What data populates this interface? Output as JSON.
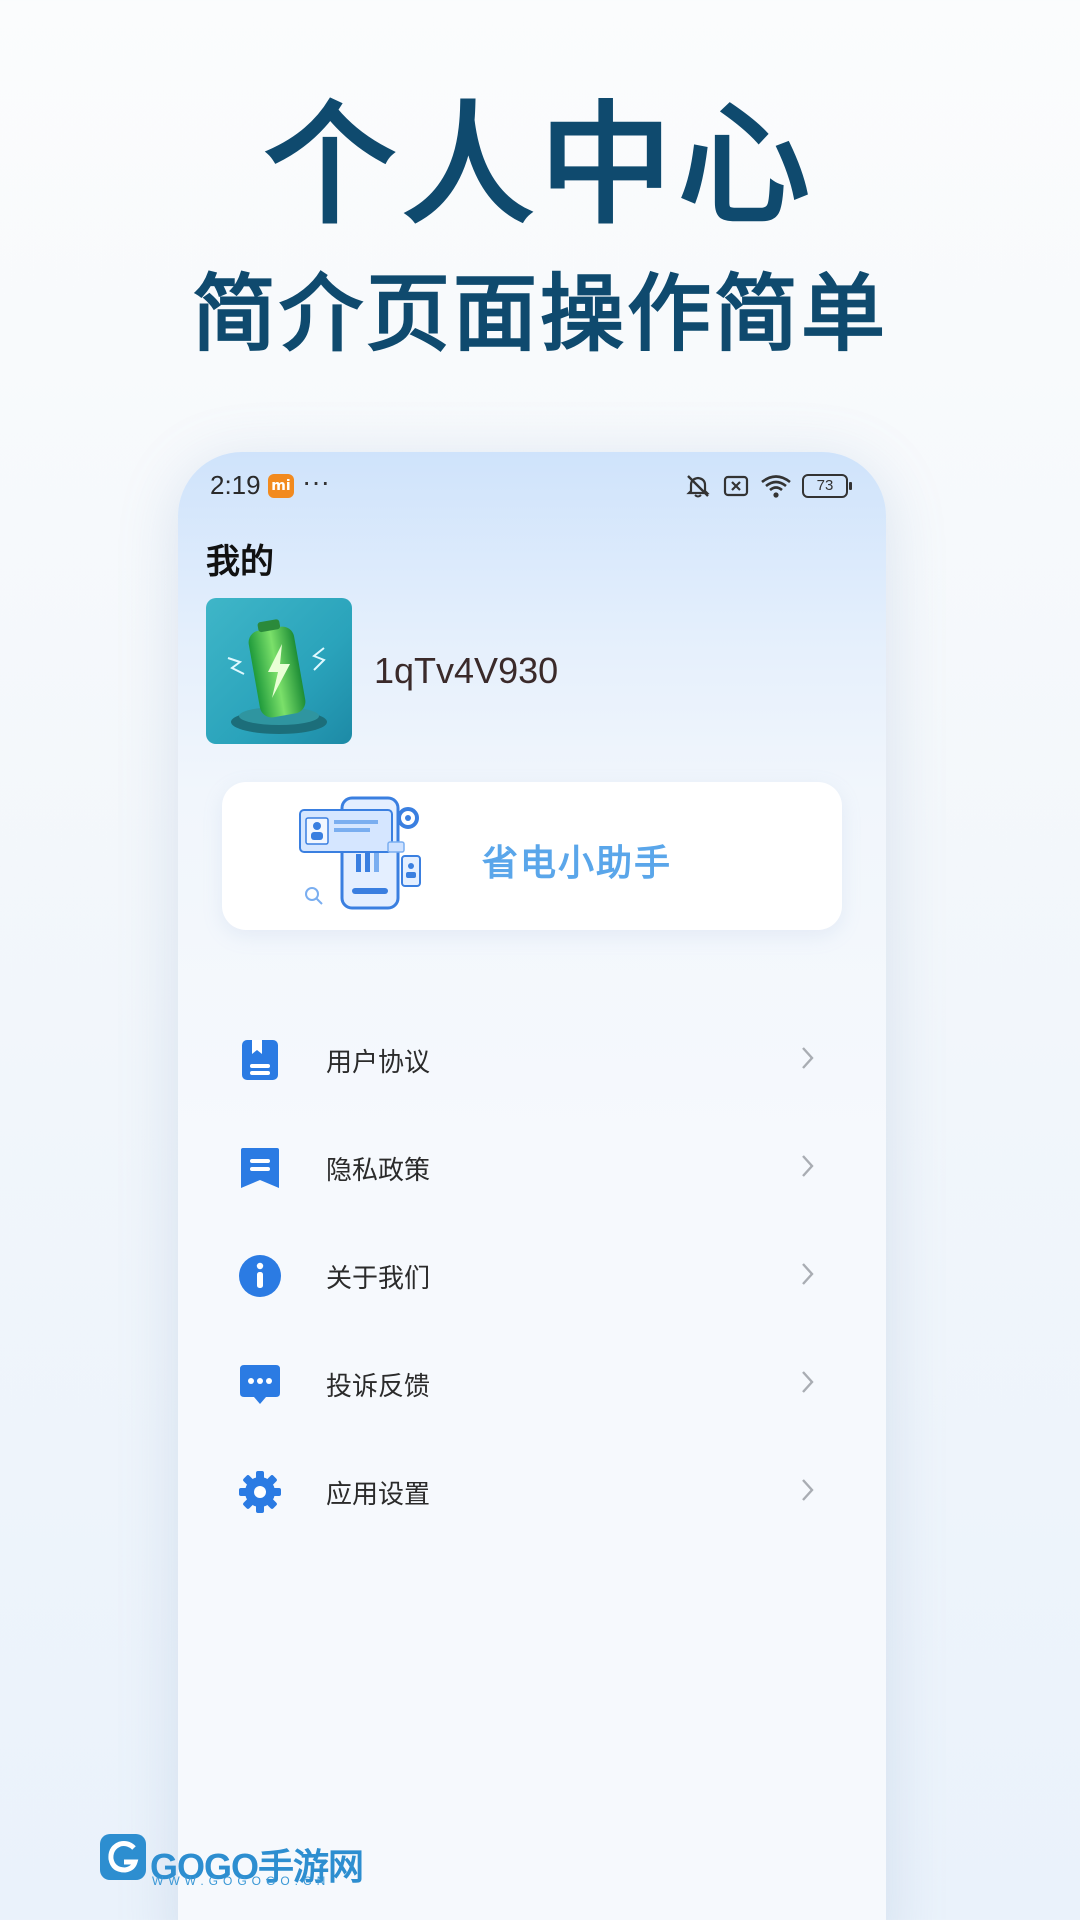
{
  "promo": {
    "title": "个人中心",
    "subtitle": "简介页面操作简单"
  },
  "status_bar": {
    "time": "2:19",
    "app_badge": "mi",
    "more": "···",
    "battery": "73",
    "icons": [
      "mute-icon",
      "no-sim-icon",
      "wifi-icon",
      "battery-icon"
    ]
  },
  "page": {
    "heading": "我的"
  },
  "profile": {
    "username": "1qTv4V930"
  },
  "assistant_card": {
    "label": "省电小助手"
  },
  "menu": {
    "items": [
      {
        "label": "用户协议",
        "icon": "document-icon"
      },
      {
        "label": "隐私政策",
        "icon": "bookmark-list-icon"
      },
      {
        "label": "关于我们",
        "icon": "info-icon"
      },
      {
        "label": "投诉反馈",
        "icon": "chat-icon"
      },
      {
        "label": "应用设置",
        "icon": "gear-icon"
      }
    ]
  },
  "watermark": {
    "brand": "GOGO手游网",
    "url": "WWW.GOGOGO.CN"
  },
  "colors": {
    "title": "#0f4a6e",
    "accent": "#2b7be3",
    "assistant": "#5aa6ea"
  }
}
